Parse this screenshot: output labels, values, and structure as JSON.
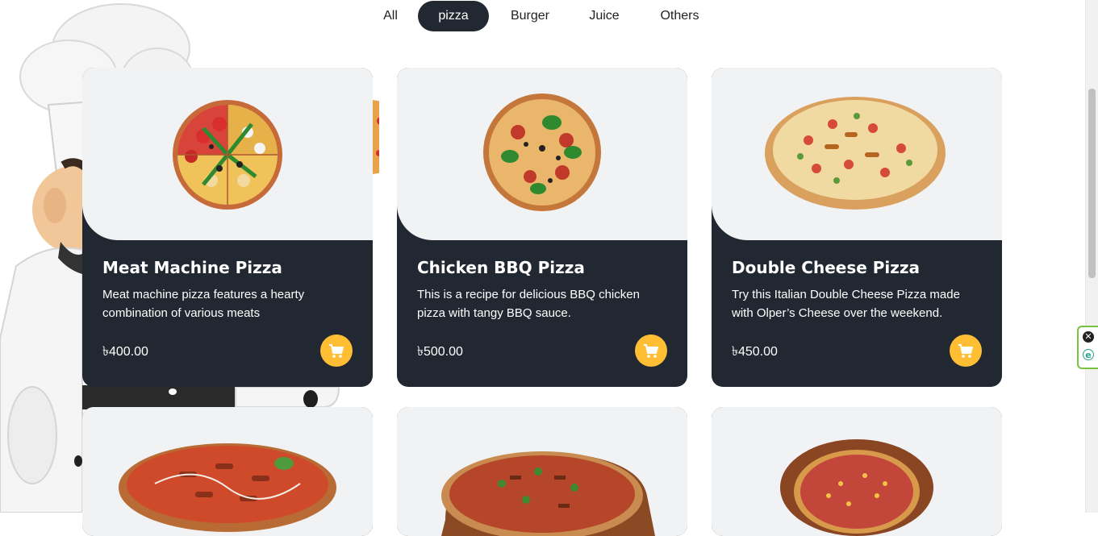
{
  "filters": {
    "items": [
      {
        "label": "All",
        "active": false
      },
      {
        "label": "pizza",
        "active": true
      },
      {
        "label": "Burger",
        "active": false
      },
      {
        "label": "Juice",
        "active": false
      },
      {
        "label": "Others",
        "active": false
      }
    ]
  },
  "products": [
    {
      "title": "Meat Machine Pizza",
      "description": "Meat machine pizza features a hearty combination of various meats",
      "price": "৳400.00"
    },
    {
      "title": "Chicken BBQ Pizza",
      "description": "This is a recipe for delicious BBQ chicken pizza with tangy BBQ sauce.",
      "price": "৳500.00"
    },
    {
      "title": "Double Cheese Pizza",
      "description": "Try this Italian Double Cheese Pizza made with Olper’s Cheese over the weekend.",
      "price": "৳450.00"
    }
  ],
  "colors": {
    "card_bg": "#222831",
    "image_bg": "#f1f2f3",
    "accent": "#ffbe33"
  },
  "icons": {
    "cart": "shopping-cart-icon",
    "close": "close-icon",
    "extension": "e-icon"
  }
}
